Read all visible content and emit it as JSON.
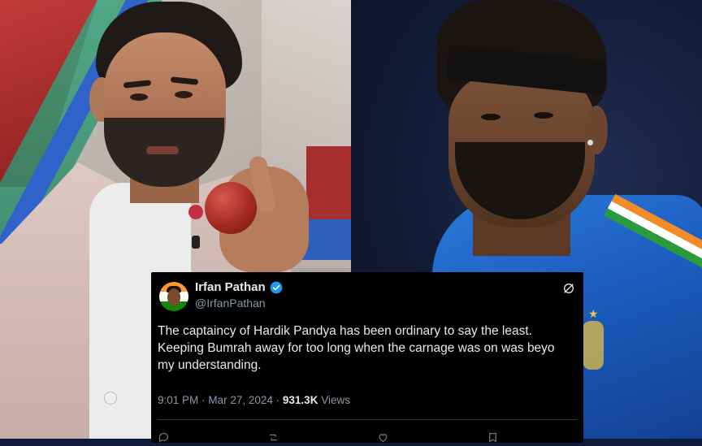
{
  "colors": {
    "tweet_bg": "#000000",
    "tweet_text": "#e7e9ea",
    "muted_text": "#8b98a5",
    "verified_blue": "#1d9bf0"
  },
  "tweet": {
    "display_name": "Irfan Pathan",
    "handle": "@IrfanPathan",
    "text_lines": [
      "The captaincy of Hardik Pandya has been ordinary to say the least.",
      "Keeping Bumrah away for too long when the carnage was on was beyo",
      "my understanding."
    ],
    "time": "9:01 PM",
    "separator": "·",
    "date": "Mar 27, 2024",
    "views_count": "931.3K",
    "views_label": "Views"
  },
  "icons": {
    "verified": "verified-badge-icon",
    "platform": "x-logo-icon",
    "reply": "reply-icon",
    "retweet": "retweet-icon",
    "like": "like-icon",
    "bookmark": "bookmark-icon"
  }
}
